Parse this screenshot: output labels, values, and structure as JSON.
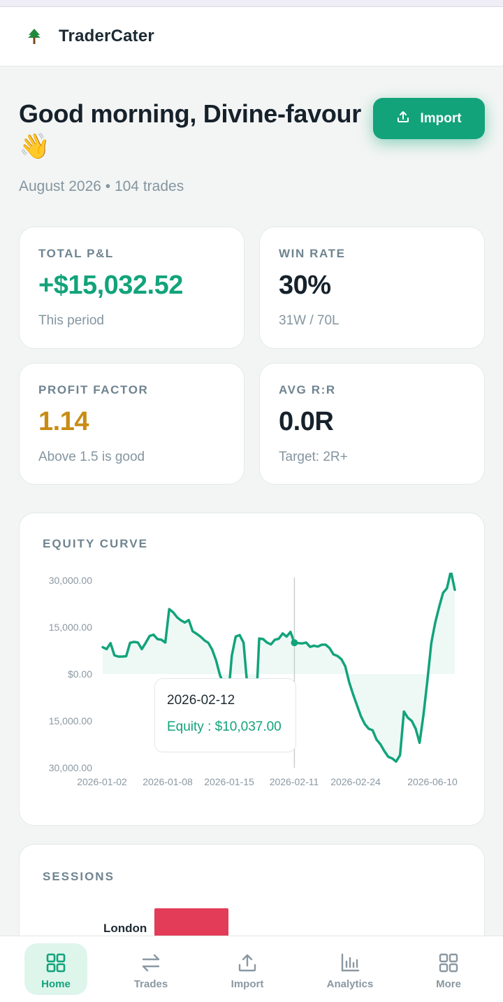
{
  "app": {
    "name": "TraderCater"
  },
  "header": {
    "greeting": "Good morning, Divine-favour",
    "emoji": "👋",
    "subtitle": "August 2026 • 104 trades",
    "import_label": "Import"
  },
  "stats": [
    {
      "label": "TOTAL P&L",
      "value": "+$15,032.52",
      "sub": "This period"
    },
    {
      "label": "WIN RATE",
      "value": "30%",
      "sub": "31W / 70L"
    },
    {
      "label": "PROFIT FACTOR",
      "value": "1.14",
      "sub": "Above 1.5 is good"
    },
    {
      "label": "AVG R:R",
      "value": "0.0R",
      "sub": "Target: 2R+"
    }
  ],
  "equity": {
    "title": "EQUITY CURVE",
    "y_ticks": [
      "30,000.00",
      "15,000.00",
      "$0.00",
      "15,000.00",
      "30,000.00"
    ],
    "x_ticks": [
      "2026-01-02",
      "2026-01-08",
      "2026-01-15",
      "2026-02-11",
      "2026-02-24",
      "2026-06-10"
    ],
    "tooltip": {
      "date": "2026-02-12",
      "equity": "Equity : $10,037.00"
    }
  },
  "chart_data": {
    "type": "area",
    "title": "EQUITY CURVE",
    "xlabel": "",
    "ylabel": "",
    "ylim": [
      -30000,
      30000
    ],
    "x_ticks": [
      "2026-01-02",
      "2026-01-08",
      "2026-01-15",
      "2026-02-11",
      "2026-02-24",
      "2026-06-10"
    ],
    "series": [
      {
        "values": [
          8600,
          8000,
          9900,
          6000,
          5600,
          5600,
          5700,
          10000,
          10300,
          10100,
          8000,
          10000,
          12200,
          12600,
          11200,
          11000,
          10100,
          20800,
          19800,
          18200,
          17200,
          16500,
          17300,
          13700,
          12900,
          12000,
          10800,
          10000,
          7800,
          4300,
          -500,
          -3300,
          -8800,
          5900,
          12000,
          12500,
          10100,
          -4300,
          -8000,
          -16000,
          11400,
          11200,
          10100,
          9500,
          11000,
          11300,
          13000,
          12000,
          13500,
          10037,
          9900,
          9800,
          10100,
          8700,
          9100,
          8800,
          9400,
          9400,
          8300,
          6300,
          5800,
          4800,
          2500,
          -2600,
          -6500,
          -10000,
          -13500,
          -16000,
          -17500,
          -18000,
          -21000,
          -22500,
          -24700,
          -26500,
          -27000,
          -28000,
          -26000,
          -12000,
          -14000,
          -15000,
          -17500,
          -22000,
          -13000,
          -2000,
          10000,
          16500,
          21500,
          26000,
          27500,
          33000,
          27000
        ]
      }
    ],
    "tooltip_index": 49
  },
  "sessions": {
    "title": "SESSIONS",
    "items": [
      {
        "label": "London"
      }
    ]
  },
  "nav": [
    {
      "label": "Home",
      "icon": "home-grid-icon"
    },
    {
      "label": "Trades",
      "icon": "swap-arrows-icon"
    },
    {
      "label": "Import",
      "icon": "upload-icon"
    },
    {
      "label": "Analytics",
      "icon": "bar-chart-icon"
    },
    {
      "label": "More",
      "icon": "grid-icon"
    }
  ],
  "colors": {
    "accent": "#12a37a",
    "amber": "#c98c13",
    "sessions_bar": "#e23c58"
  }
}
